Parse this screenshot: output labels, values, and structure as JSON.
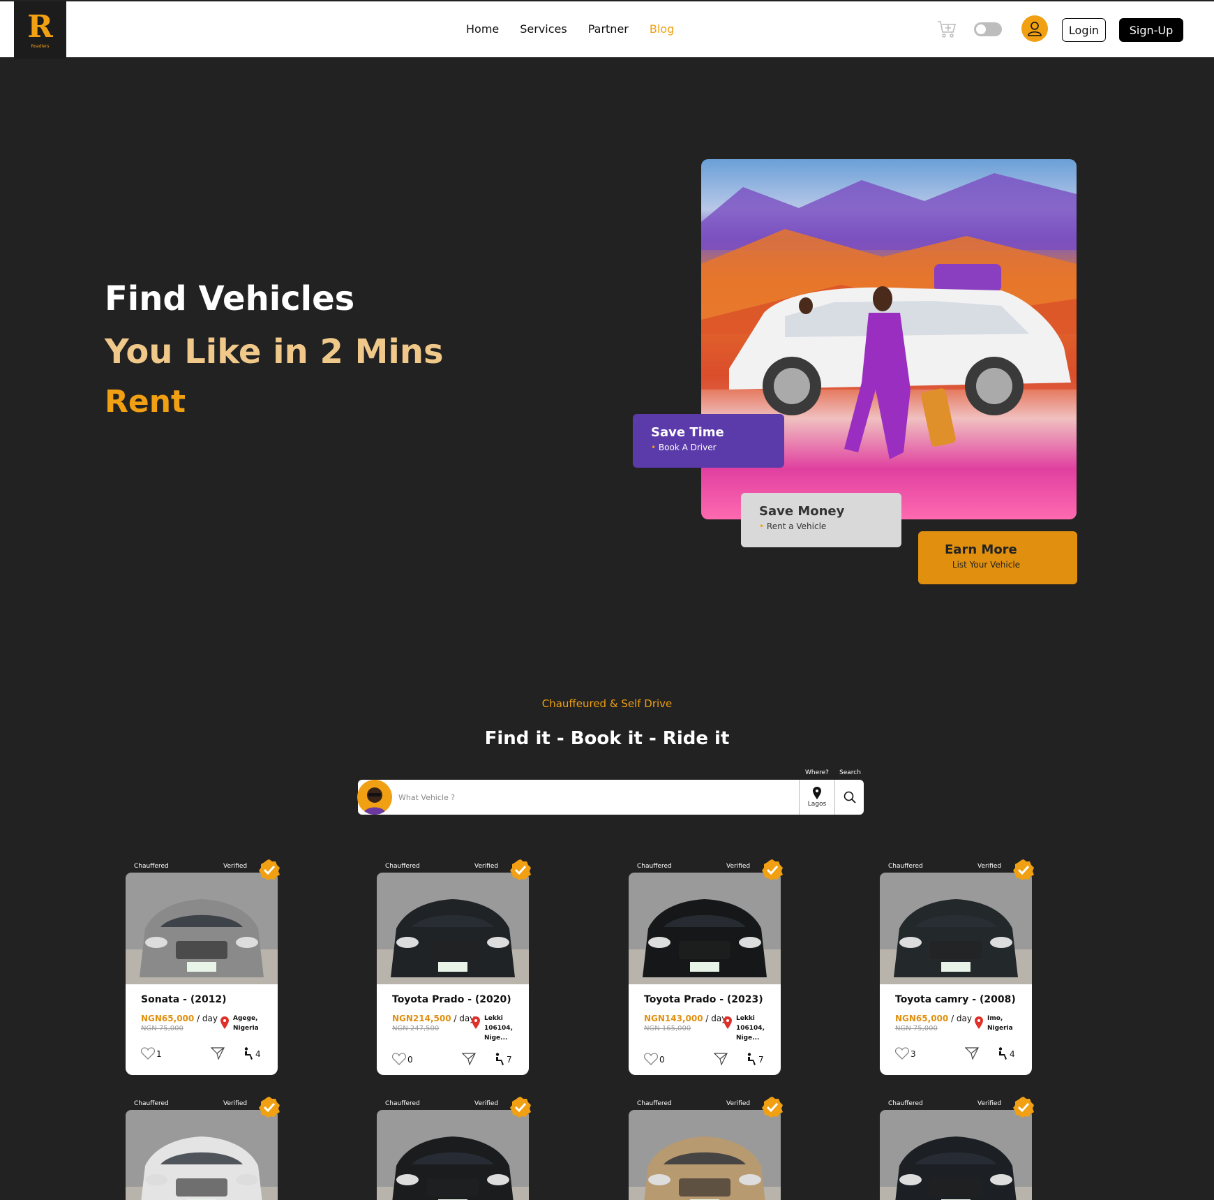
{
  "brand": {
    "logo_mark": "R",
    "logo_word": "Roadlers",
    "accent": "#f0a012"
  },
  "nav": {
    "links": [
      "Home",
      "Services",
      "Partner",
      "Blog"
    ],
    "active": "Blog",
    "login": "Login",
    "signup": "Sign-Up"
  },
  "hero": {
    "line1": "Find Vehicles",
    "line2": "You Like in 2 Mins",
    "line3": "Rent",
    "badges": [
      {
        "title": "Save Time",
        "sub": "Book A Driver"
      },
      {
        "title": "Save Money",
        "sub": "Rent a Vehicle"
      },
      {
        "title": "Earn More",
        "sub": "List Your Vehicle"
      }
    ]
  },
  "search": {
    "eyebrow": "Chauffeured & Self Drive",
    "title": "Find it - Book it - Ride it",
    "placeholder": "What Vehicle ?",
    "where_label": "Where?",
    "search_label": "Search",
    "location": "Lagos"
  },
  "cards": [
    {
      "type": "Chauffered",
      "status": "Verified",
      "name": "Sonata - (2012)",
      "price": "NGN65,000",
      "unit": "/ day",
      "old": "NGN 75,000",
      "loc": [
        "Agege,",
        "Nigeria"
      ],
      "likes": "1",
      "seats": "4",
      "color": "#8a8a8a"
    },
    {
      "type": "Chauffered",
      "status": "Verified",
      "name": "Toyota Prado - (2020)",
      "price": "NGN214,500",
      "unit": "/ day",
      "old": "NGN 247,500",
      "loc": [
        "Lekki",
        "106104,",
        "Nige..."
      ],
      "likes": "0",
      "seats": "7",
      "color": "#1f2326"
    },
    {
      "type": "Chauffered",
      "status": "Verified",
      "name": "Toyota Prado - (2023)",
      "price": "NGN143,000",
      "unit": "/ day",
      "old": "NGN 165,000",
      "loc": [
        "Lekki",
        "106104,",
        "Nige..."
      ],
      "likes": "0",
      "seats": "7",
      "color": "#151718"
    },
    {
      "type": "Chauffered",
      "status": "Verified",
      "name": "Toyota camry - (2008)",
      "price": "NGN65,000",
      "unit": "/ day",
      "old": "NGN 75,000",
      "loc": [
        "Imo,",
        "Nigeria"
      ],
      "likes": "3",
      "seats": "4",
      "color": "#23282b"
    },
    {
      "type": "Chauffered",
      "status": "Verified",
      "color": "#e4e4e4"
    },
    {
      "type": "Chauffered",
      "status": "Verified",
      "color": "#1a1c1e"
    },
    {
      "type": "Chauffered",
      "status": "Verified",
      "color": "#b89a70"
    },
    {
      "type": "Chauffered",
      "status": "Verified",
      "color": "#1c2024"
    }
  ]
}
